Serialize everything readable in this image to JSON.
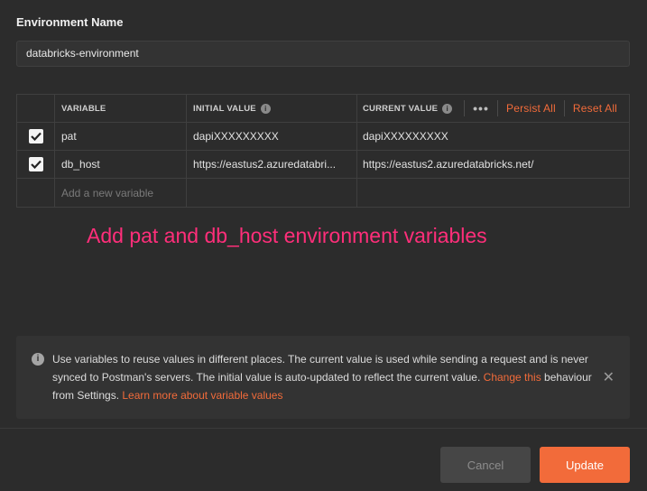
{
  "environment": {
    "label": "Environment Name",
    "value": "databricks-environment"
  },
  "table": {
    "headers": {
      "variable": "VARIABLE",
      "initial_value": "INITIAL VALUE",
      "current_value": "CURRENT VALUE",
      "more": "•••",
      "persist_all": "Persist All",
      "reset_all": "Reset All"
    },
    "rows": [
      {
        "checked": true,
        "variable": "pat",
        "initial_value": "dapiXXXXXXXXX",
        "current_value": "dapiXXXXXXXXX"
      },
      {
        "checked": true,
        "variable": "db_host",
        "initial_value": "https://eastus2.azuredatabri...",
        "current_value": "https://eastus2.azuredatabricks.net/"
      }
    ],
    "new_variable_placeholder": "Add a new variable"
  },
  "annotation": "Add pat and db_host environment variables",
  "notice": {
    "text_part1": "Use variables to reuse values in different places. The current value is used while sending a request and is never synced to Postman's servers. The initial value is auto-updated to reflect the current value. ",
    "change_link": "Change this",
    "text_part2": " behaviour from Settings. ",
    "learn_link": "Learn more about variable values"
  },
  "buttons": {
    "cancel": "Cancel",
    "update": "Update"
  },
  "colors": {
    "accent": "#f26b3a",
    "annotation": "#ff2e7a",
    "background": "#2c2c2c"
  }
}
